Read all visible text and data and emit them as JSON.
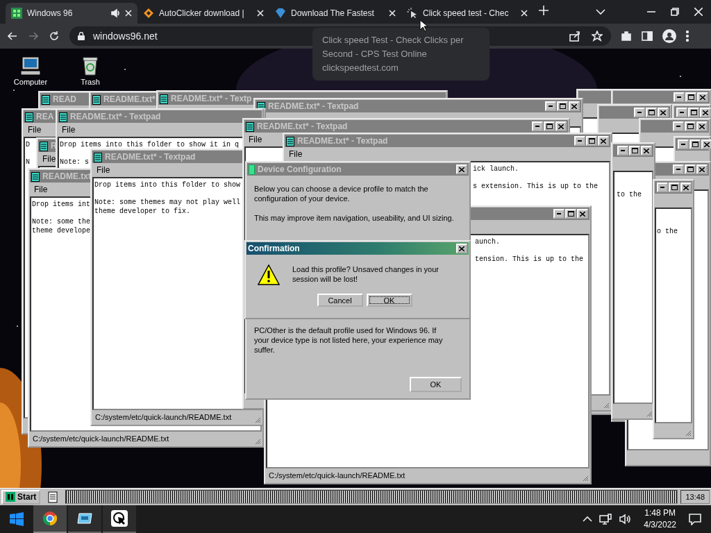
{
  "browser": {
    "tabs": [
      {
        "title": "Windows 96",
        "selected": true,
        "audio": true
      },
      {
        "title": "AutoClicker download |",
        "selected": false,
        "audio": false
      },
      {
        "title": "Download The Fastest",
        "selected": false,
        "audio": false
      },
      {
        "title": "Click speed test - Chec",
        "selected": false,
        "audio": false
      }
    ],
    "address": "windows96.net",
    "tooltip": {
      "title": "Click speed Test - Check Clicks per Second - CPS Test Online",
      "url": "clickspeedtest.com"
    }
  },
  "desktop_icons": [
    {
      "label": "Computer"
    },
    {
      "label": "Trash"
    }
  ],
  "windows": [
    {
      "title": "READ"
    },
    {
      "title": "README.txt*"
    },
    {
      "title": "README.txt* - Textp"
    },
    {
      "title": "README.txt* - Textpad"
    },
    {
      "title": "REA",
      "menu": "File",
      "paragraphs": [
        "D",
        "N"
      ]
    },
    {
      "title": "R",
      "menu": "File"
    },
    {
      "title": "README.txt* - Textpad",
      "menu": "File",
      "paragraphs": [
        "Drop items into this folder to show it in q",
        "Note: s"
      ]
    },
    {
      "title": "README.txt",
      "menu": "File",
      "paragraphs": [
        "Drop items int",
        "Note: some the\ntheme develope"
      ],
      "status": "C:/system/etc/quick-launch/README.txt"
    },
    {
      "title": "README.txt* - Textpad",
      "menu": "File",
      "paragraphs": [
        "Drop items into this folder to show",
        "Note: some themes may not play well\ntheme developer to fix."
      ],
      "status": "C:/system/etc/quick-launch/README.txt"
    },
    {
      "title": "README.txt* - Textpad",
      "menu": "File"
    },
    {
      "title": "README.txt* - Textpad",
      "menu": "File",
      "paragraphs": [
        "ick launch.",
        "s extension. This is up to the"
      ]
    },
    {
      "paragraphs": [
        "aunch.",
        "tension. This is up to the"
      ],
      "status": "C:/system/etc/quick-launch/README.txt"
    },
    {
      "paragraphs": [
        "to the"
      ]
    },
    {
      "paragraphs": [
        "o the"
      ]
    }
  ],
  "device_configuration": {
    "title": "Device Configuration",
    "paragraphs": [
      "Below you can choose a device profile to match the configuration of your device.",
      "This may improve item navigation, useability, and UI sizing."
    ],
    "note": "PC/Other is the default profile used for Windows 96. If your device type is not listed here, your experience may suffer.",
    "button": "OK"
  },
  "confirmation": {
    "title": "Confirmation",
    "message": "Load this profile? Unsaved changes in your session will be lost!",
    "buttons": [
      {
        "label": "Cancel",
        "focused": false
      },
      {
        "label": "OK",
        "focused": true
      }
    ]
  },
  "win96_taskbar": {
    "start": "Start",
    "clock": "13:48"
  },
  "os_taskbar": {
    "apps": [
      {
        "selected": true
      },
      {
        "selected": false
      },
      {
        "selected": false
      }
    ],
    "time": "1:48 PM",
    "date": "4/3/2022"
  }
}
